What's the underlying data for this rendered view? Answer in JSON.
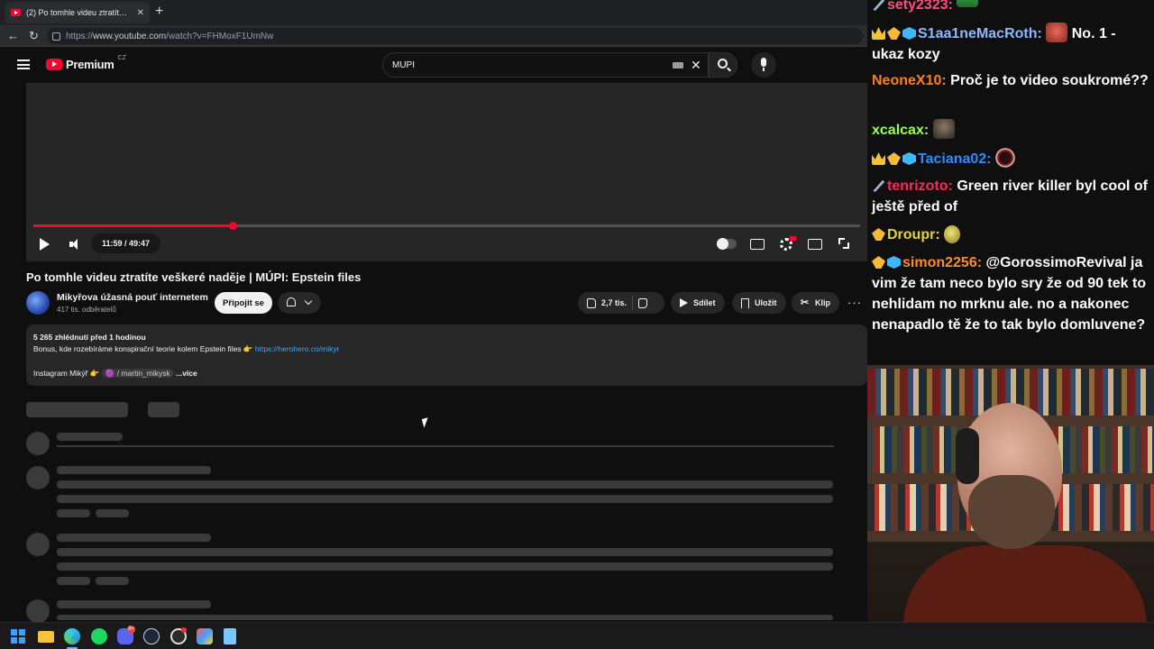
{
  "browser": {
    "tab_title": "(2) Po tomhle videu ztratíte veškeré naděje | MÚPI: Epstein files",
    "tab_close": "✕",
    "new_tab": "+",
    "url_prefix": "https://",
    "url_host": "www.youtube.com",
    "url_path": "/watch?v=FHMoxF1UmNw"
  },
  "youtube": {
    "logo_word": "Premium",
    "logo_country": "CZ",
    "search_value": "MUPI",
    "player": {
      "progress_fraction": 0.2407,
      "time_text": "11:59 / 49:47"
    },
    "video_title": "Po tomhle videu ztratíte veškeré naděje | MÚPI: Epstein files",
    "channel_name": "Mikyřova úžasná pouť internetem",
    "subscribers": "417 tis. odběratelů",
    "subscribe_label": "Připojit se",
    "likes": "2,7 tis.",
    "share_label": "Sdílet",
    "save_label": "Uložit",
    "clip_label": "Klip",
    "more_label": "···",
    "description": {
      "meta": "5 265 zhlédnutí  před 1 hodinou",
      "line1": "Bonus, kde rozebíráme konspirační teorie kolem Epstein files 👉 ",
      "link": "https://herohero.co/mikyr",
      "line2_prefix": "Instagram Mikýř 👉 ",
      "handle": "🟣 / martin_mikysk",
      "more_link": "...více"
    }
  },
  "chat": {
    "messages": [
      {
        "user": "sety2323:",
        "color": "#ff4f81",
        "text": ""
      },
      {
        "user": "S1aa1neMacRoth:",
        "color": "#8fb8ff",
        "text": "No. 1 - ukaz kozy"
      },
      {
        "user": "NeoneX10:",
        "color": "#ff7f24",
        "text": "Proč je to video soukromé??"
      },
      {
        "user": "xcalcax:",
        "color": "#9aff52",
        "text": ""
      },
      {
        "user": "Taciana02:",
        "color": "#2f8cff",
        "text": ""
      },
      {
        "user": "tenrizoto:",
        "color": "#ff2a55",
        "text": "Green river killer byl cool of ještě před of"
      },
      {
        "user": "Droupr:",
        "color": "#e3d33c",
        "text": ""
      },
      {
        "user": "simon2256:",
        "color": "#ff8c2a",
        "text": "@GorossimoRevival ja vim že tam neco bylo sry že od 90 tek to nehlidam no mrknu ale. no a nakonec nenapadlo tě že to tak bylo domluvene?"
      }
    ]
  },
  "taskbar": {
    "discord_badge": "9+"
  },
  "colors": {
    "accent_red": "#ff0033",
    "link_blue": "#3ea6ff",
    "bg": "#0f0f0f"
  }
}
